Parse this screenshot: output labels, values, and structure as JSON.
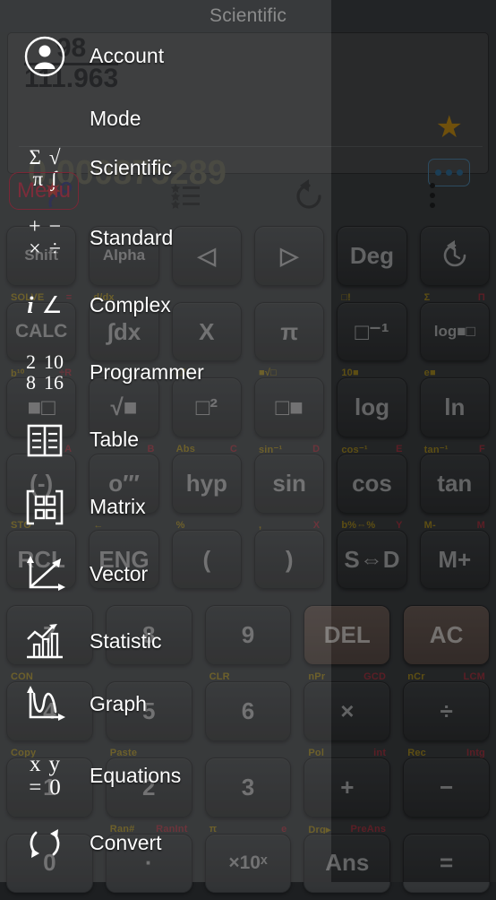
{
  "app": {
    "title": "Scientific",
    "accent_gold": "#c08b16",
    "accent_blue": "#2f6b95",
    "menu_border": "#7a2736"
  },
  "display": {
    "expression_numerator": "98",
    "expression_denominator": "111.963",
    "result": "0.000875289",
    "star_icon": "star-icon",
    "more_button_icon": "ellipsis-icon"
  },
  "toolbar": {
    "items": [
      {
        "icon": "new-sparkle-icon",
        "name": "toolbar-new"
      },
      {
        "icon": "favorites-list-icon",
        "name": "toolbar-favorites"
      },
      {
        "icon": "undo-icon",
        "name": "toolbar-undo"
      },
      {
        "icon": "overflow-menu-icon",
        "name": "toolbar-overflow"
      }
    ]
  },
  "menu_button": {
    "label": "Menu"
  },
  "drawer": {
    "items": [
      {
        "label": "Account",
        "icon": "account-avatar-icon"
      },
      {
        "label": "Mode",
        "icon": "none"
      },
      {
        "label": "Scientific",
        "icon": "sigma-sqrt-pi-integral-icon"
      },
      {
        "label": "Standard",
        "icon": "plus-minus-times-divide-icon"
      },
      {
        "label": "Complex",
        "icon": "imaginary-angle-icon"
      },
      {
        "label": "Programmer",
        "icon": "radix-2-10-8-16-icon"
      },
      {
        "label": "Table",
        "icon": "table-grid-icon"
      },
      {
        "label": "Matrix",
        "icon": "matrix-brackets-icon"
      },
      {
        "label": "Vector",
        "icon": "vector-axes-arrow-icon"
      },
      {
        "label": "Statistic",
        "icon": "bar-chart-trend-icon"
      },
      {
        "label": "Graph",
        "icon": "wave-curve-axes-icon"
      },
      {
        "label": "Equations",
        "icon": "x-y-equals-zero-icon"
      },
      {
        "label": "Convert",
        "icon": "circular-arrows-icon"
      }
    ]
  },
  "keypad": {
    "rows": [
      [
        {
          "label": "Shift",
          "top_left": "",
          "top_right": "",
          "style": ""
        },
        {
          "label": "Alpha",
          "top_left": "",
          "top_right": "",
          "style": ""
        },
        {
          "label": "◁",
          "top_left": "",
          "top_right": "",
          "style": ""
        },
        {
          "label": "▷",
          "top_left": "",
          "top_right": "",
          "style": ""
        },
        {
          "label": "Deg",
          "top_left": "",
          "top_right": "",
          "style": ""
        },
        {
          "label": "history-icon",
          "top_left": "",
          "top_right": "",
          "style": ""
        }
      ],
      [
        {
          "label": "CALC",
          "top_left": "SOLVE",
          "top_right": "=",
          "style": ""
        },
        {
          "label": "∫dx",
          "top_left": "d/dx",
          "top_right": "",
          "style": ""
        },
        {
          "label": "X",
          "top_left": "",
          "top_right": "",
          "style": ""
        },
        {
          "label": "π",
          "top_left": "",
          "top_right": "",
          "style": ""
        },
        {
          "label": "□⁻¹",
          "top_left": "□!",
          "top_right": "",
          "style": ""
        },
        {
          "label": "log■□",
          "top_left": "Σ",
          "top_right": "Π",
          "style": ""
        }
      ],
      [
        {
          "label": "■□",
          "top_left": "b¹⁰",
          "top_right": "÷R",
          "style": ""
        },
        {
          "label": "√■",
          "top_left": "",
          "top_right": "",
          "style": ""
        },
        {
          "label": "□²",
          "top_left": "□³",
          "top_right": "",
          "style": ""
        },
        {
          "label": "□■",
          "top_left": "■√□",
          "top_right": "",
          "style": ""
        },
        {
          "label": "log",
          "top_left": "10■",
          "top_right": "",
          "style": ""
        },
        {
          "label": "ln",
          "top_left": "e■",
          "top_right": "",
          "style": ""
        }
      ],
      [
        {
          "label": "(-)",
          "top_left": "",
          "top_right": "A",
          "style": ""
        },
        {
          "label": "o′″",
          "top_left": "",
          "top_right": "B",
          "style": ""
        },
        {
          "label": "hyp",
          "top_left": "Abs",
          "top_right": "C",
          "style": ""
        },
        {
          "label": "sin",
          "top_left": "sin⁻¹",
          "top_right": "D",
          "style": ""
        },
        {
          "label": "cos",
          "top_left": "cos⁻¹",
          "top_right": "E",
          "style": ""
        },
        {
          "label": "tan",
          "top_left": "tan⁻¹",
          "top_right": "F",
          "style": ""
        }
      ],
      [
        {
          "label": "RCL",
          "top_left": "STO",
          "top_right": "",
          "style": ""
        },
        {
          "label": "ENG",
          "top_left": "←",
          "top_right": "",
          "style": ""
        },
        {
          "label": "(",
          "top_left": "%",
          "top_right": "",
          "style": ""
        },
        {
          "label": ")",
          "top_left": ",",
          "top_right": "X",
          "style": ""
        },
        {
          "label": "S⇔D",
          "top_left": "b%⇔%",
          "top_right": "Y",
          "style": ""
        },
        {
          "label": "M+",
          "top_left": "M-",
          "top_right": "M",
          "style": ""
        }
      ],
      [
        {
          "label": "7",
          "top_left": "",
          "top_right": "",
          "style": ""
        },
        {
          "label": "8",
          "top_left": "",
          "top_right": "",
          "style": ""
        },
        {
          "label": "9",
          "top_left": "",
          "top_right": "",
          "style": ""
        },
        {
          "label": "DEL",
          "top_left": "",
          "top_right": "",
          "style": "warm"
        },
        {
          "label": "AC",
          "top_left": "",
          "top_right": "",
          "style": "warm"
        }
      ],
      [
        {
          "label": "4",
          "top_left": "CON",
          "top_right": "",
          "style": ""
        },
        {
          "label": "5",
          "top_left": "",
          "top_right": "",
          "style": ""
        },
        {
          "label": "6",
          "top_left": "CLR",
          "top_right": "",
          "style": ""
        },
        {
          "label": "×",
          "top_left": "nPr",
          "top_right": "GCD",
          "style": ""
        },
        {
          "label": "÷",
          "top_left": "nCr",
          "top_right": "LCM",
          "style": ""
        }
      ],
      [
        {
          "label": "1",
          "top_left": "Copy",
          "top_right": "",
          "style": ""
        },
        {
          "label": "2",
          "top_left": "Paste",
          "top_right": "",
          "style": ""
        },
        {
          "label": "3",
          "top_left": "",
          "top_right": "",
          "style": ""
        },
        {
          "label": "+",
          "top_left": "Pol",
          "top_right": "int",
          "style": ""
        },
        {
          "label": "−",
          "top_left": "Rec",
          "top_right": "Intg",
          "style": ""
        }
      ],
      [
        {
          "label": "0",
          "top_left": "",
          "top_right": "",
          "style": ""
        },
        {
          "label": "·",
          "top_left": "Ran#",
          "top_right": "RanInt",
          "style": ""
        },
        {
          "label": "×10ˣ",
          "top_left": "π",
          "top_right": "e",
          "style": ""
        },
        {
          "label": "Ans",
          "top_left": "Drg▸",
          "top_right": "PreAns",
          "style": ""
        },
        {
          "label": "=",
          "top_left": "",
          "top_right": "",
          "style": ""
        }
      ]
    ]
  }
}
